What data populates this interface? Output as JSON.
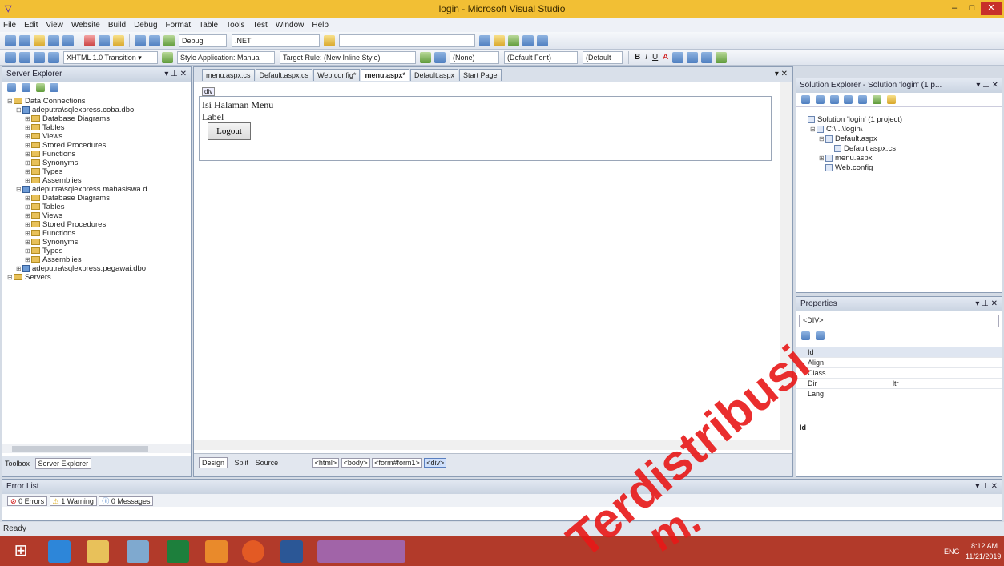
{
  "window": {
    "title": "login - Microsoft Visual Studio",
    "controls": [
      "–",
      "□",
      "✕"
    ]
  },
  "menu": [
    "File",
    "Edit",
    "View",
    "Website",
    "Build",
    "Debug",
    "Format",
    "Table",
    "Tools",
    "Test",
    "Window",
    "Help"
  ],
  "toolbar1": {
    "config": "Debug",
    "platform": ".NET"
  },
  "toolbar2": {
    "doctype": "XHTML 1.0 Transition ▾",
    "style_app": "Style Application: Manual",
    "target_rule": "Target Rule: (New Inline Style)",
    "rule_combo": "(None)",
    "font_combo": "(Default Font)",
    "size_combo": "(Default"
  },
  "server_explorer": {
    "title": "Server Explorer",
    "tree": [
      {
        "indent": 0,
        "exp": "⊟",
        "icon": "folder",
        "label": "Data Connections"
      },
      {
        "indent": 1,
        "exp": "⊟",
        "icon": "db",
        "label": "adeputra\\sqlexpress.coba.dbo"
      },
      {
        "indent": 2,
        "exp": "⊞",
        "icon": "folder",
        "label": "Database Diagrams"
      },
      {
        "indent": 2,
        "exp": "⊞",
        "icon": "folder",
        "label": "Tables"
      },
      {
        "indent": 2,
        "exp": "⊞",
        "icon": "folder",
        "label": "Views"
      },
      {
        "indent": 2,
        "exp": "⊞",
        "icon": "folder",
        "label": "Stored Procedures"
      },
      {
        "indent": 2,
        "exp": "⊞",
        "icon": "folder",
        "label": "Functions"
      },
      {
        "indent": 2,
        "exp": "⊞",
        "icon": "folder",
        "label": "Synonyms"
      },
      {
        "indent": 2,
        "exp": "⊞",
        "icon": "folder",
        "label": "Types"
      },
      {
        "indent": 2,
        "exp": "⊞",
        "icon": "folder",
        "label": "Assemblies"
      },
      {
        "indent": 1,
        "exp": "⊟",
        "icon": "db",
        "label": "adeputra\\sqlexpress.mahasiswa.d"
      },
      {
        "indent": 2,
        "exp": "⊞",
        "icon": "folder",
        "label": "Database Diagrams"
      },
      {
        "indent": 2,
        "exp": "⊞",
        "icon": "folder",
        "label": "Tables"
      },
      {
        "indent": 2,
        "exp": "⊞",
        "icon": "folder",
        "label": "Views"
      },
      {
        "indent": 2,
        "exp": "⊞",
        "icon": "folder",
        "label": "Stored Procedures"
      },
      {
        "indent": 2,
        "exp": "⊞",
        "icon": "folder",
        "label": "Functions"
      },
      {
        "indent": 2,
        "exp": "⊞",
        "icon": "folder",
        "label": "Synonyms"
      },
      {
        "indent": 2,
        "exp": "⊞",
        "icon": "folder",
        "label": "Types"
      },
      {
        "indent": 2,
        "exp": "⊞",
        "icon": "folder",
        "label": "Assemblies"
      },
      {
        "indent": 1,
        "exp": "⊞",
        "icon": "db",
        "label": "adeputra\\sqlexpress.pegawai.dbo"
      },
      {
        "indent": 0,
        "exp": "⊞",
        "icon": "folder",
        "label": "Servers"
      }
    ],
    "bottom_tabs": [
      "Toolbox",
      "Server Explorer"
    ]
  },
  "editor": {
    "tabs": [
      "menu.aspx.cs",
      "Default.aspx.cs",
      "Web.config*",
      "menu.aspx*",
      "Default.aspx",
      "Start Page"
    ],
    "active_tab": 3,
    "div_tag": "div",
    "content_line": "Isi Halaman Menu",
    "label": "Label",
    "logout": "Logout",
    "view_tabs": [
      "Design",
      "Split",
      "Source"
    ],
    "breadcrumb": [
      "<html>",
      "<body>",
      "<form#form1>",
      "<div>"
    ]
  },
  "solution_explorer": {
    "title": "Solution Explorer - Solution 'login' (1 p...",
    "tree": [
      {
        "indent": 0,
        "exp": "",
        "label": "Solution 'login' (1 project)"
      },
      {
        "indent": 1,
        "exp": "⊟",
        "label": "C:\\...\\login\\"
      },
      {
        "indent": 2,
        "exp": "⊟",
        "label": "Default.aspx"
      },
      {
        "indent": 3,
        "exp": "",
        "label": "Default.aspx.cs"
      },
      {
        "indent": 2,
        "exp": "⊞",
        "label": "menu.aspx"
      },
      {
        "indent": 2,
        "exp": "",
        "label": "Web.config"
      }
    ]
  },
  "properties": {
    "title": "Properties",
    "object": "<DIV>",
    "rows": [
      {
        "k": "Id",
        "v": ""
      },
      {
        "k": "Align",
        "v": ""
      },
      {
        "k": "Class",
        "v": ""
      },
      {
        "k": "Dir",
        "v": "ltr"
      },
      {
        "k": "Lang",
        "v": ""
      }
    ],
    "desc": "Id"
  },
  "error_list": {
    "title": "Error List",
    "errors": "0 Errors",
    "warnings": "1 Warning",
    "messages": "0 Messages"
  },
  "status": "Ready",
  "taskbar": {
    "lang": "ENG",
    "time": "8:12 AM",
    "date": "11/21/2019"
  },
  "watermark": {
    "text1": "Terdistribusi",
    "text2": "m."
  },
  "colors": {
    "title": "#f2bf34",
    "taskbar": "#b23a2a",
    "watermark": "#e81818"
  }
}
